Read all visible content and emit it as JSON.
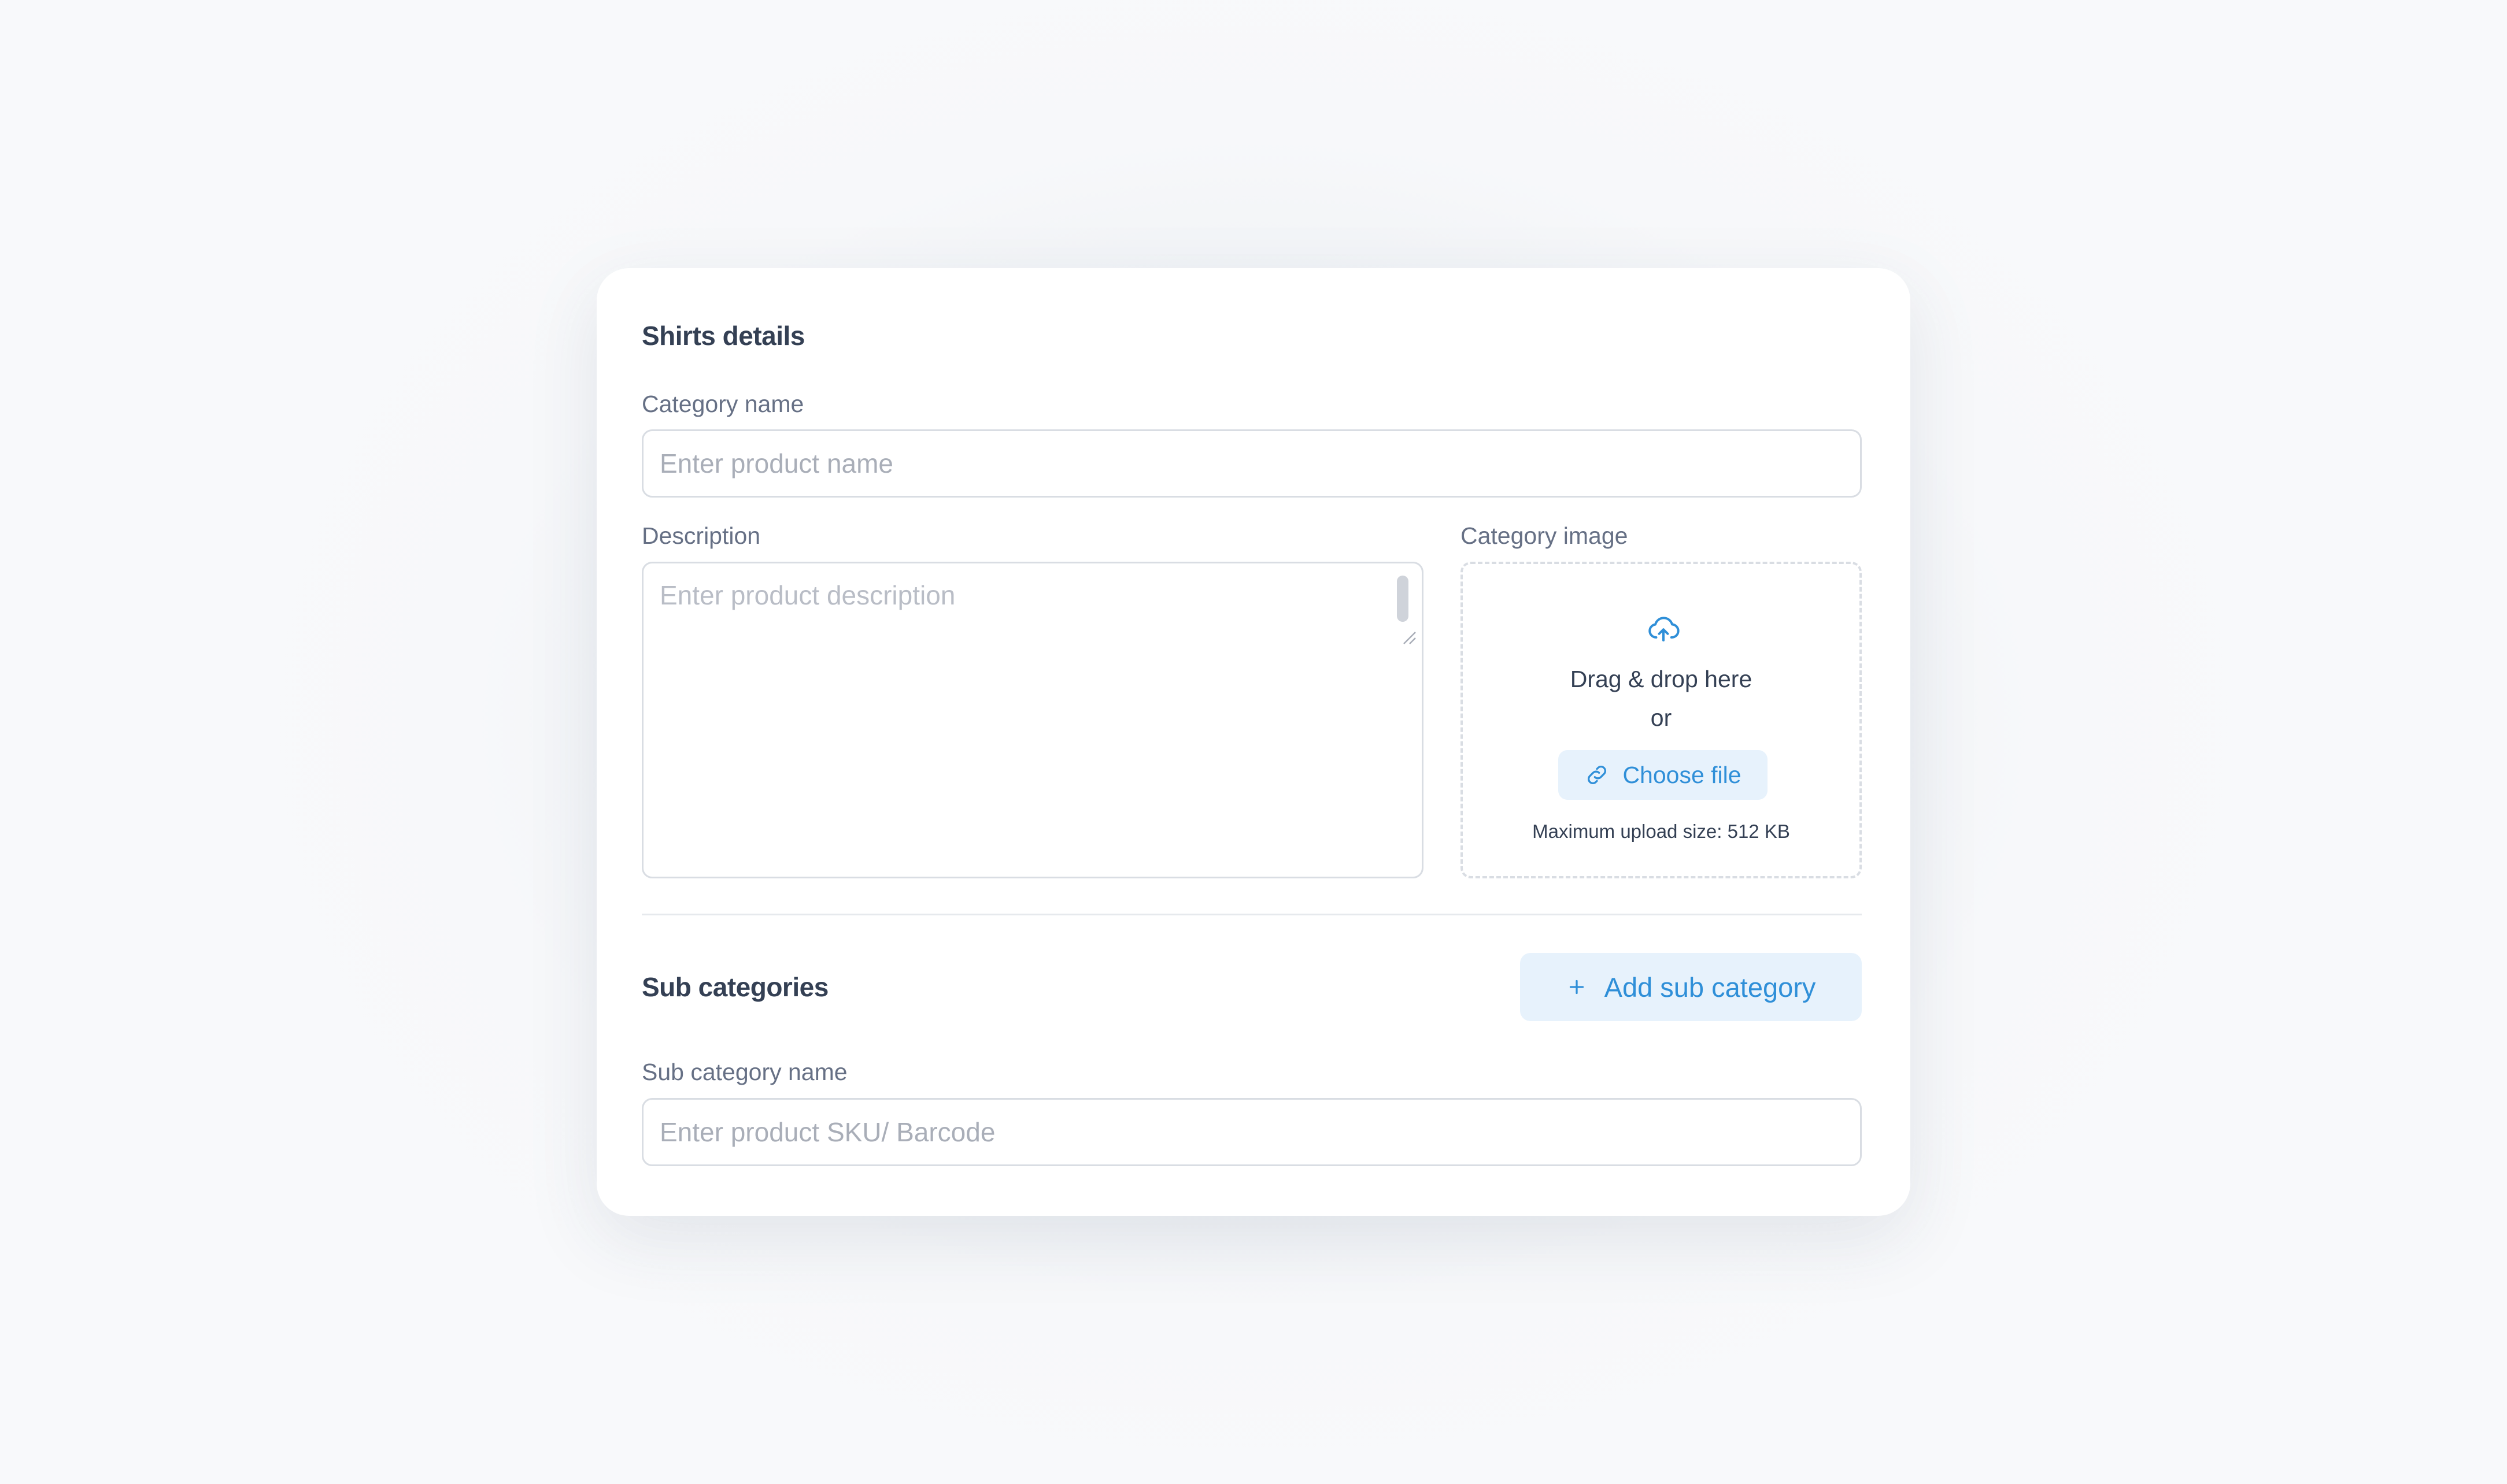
{
  "details": {
    "title": "Shirts details",
    "category_name_label": "Category name",
    "category_name_placeholder": "Enter product name",
    "category_name_value": "",
    "description_label": "Description",
    "description_placeholder": "Enter product description",
    "description_value": "",
    "category_image_label": "Category image"
  },
  "upload": {
    "icon": "cloud-upload-icon",
    "drag_text": "Drag & drop here",
    "or_text": "or",
    "choose_button_icon": "link-icon",
    "choose_button_label": "Choose file",
    "max_size_text": "Maximum upload size: 512 KB"
  },
  "sub_categories": {
    "title": "Sub categories",
    "add_button_icon": "plus-icon",
    "add_button_label": "Add sub category",
    "name_label": "Sub category name",
    "name_placeholder": "Enter product SKU/ Barcode",
    "name_value": ""
  },
  "colors": {
    "accent": "#2f8fd8",
    "accent_bg": "#e7f2fc",
    "text_primary": "#344054",
    "text_secondary": "#667085",
    "border": "#d9dde3"
  }
}
